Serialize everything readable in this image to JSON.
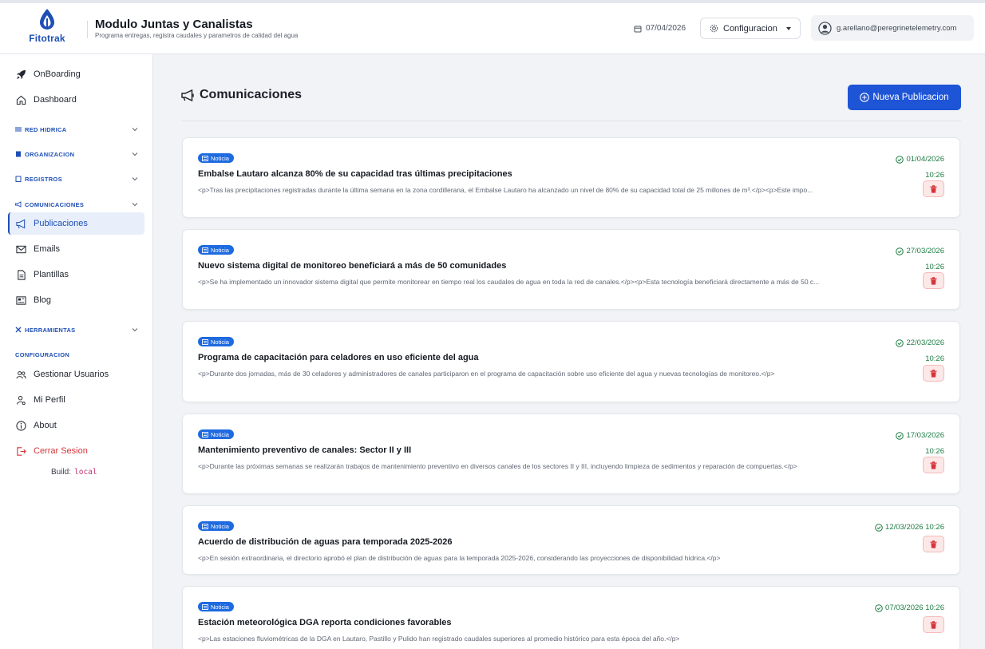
{
  "brand": {
    "name": "Fitotrak"
  },
  "header": {
    "title": "Modulo Juntas y Canalistas",
    "subtitle": "Programa entregas, registra caudales y parametros de calidad del agua",
    "date": "07/04/2026",
    "config_label": "Configuracion",
    "user_email": "g.arellano@peregrinetelemetry.com"
  },
  "sidebar": {
    "onboarding": "OnBoarding",
    "dashboard": "Dashboard",
    "sec_red": "RED HIDRICA",
    "sec_org": "ORGANIZACION",
    "sec_reg": "REGISTROS",
    "sec_com": "COMUNICACIONES",
    "publicaciones": "Publicaciones",
    "emails": "Emails",
    "plantillas": "Plantillas",
    "blog": "Blog",
    "sec_herr": "HERRAMIENTAS",
    "sec_cfg": "CONFIGURACION",
    "usuarios": "Gestionar Usuarios",
    "perfil": "Mi Perfil",
    "about": "About",
    "logout": "Cerrar Sesion",
    "build_label": "Build:",
    "build_value": "local"
  },
  "main": {
    "title": "Comunicaciones",
    "new_button": "Nueva Publicacion"
  },
  "posts": [
    {
      "badge": "Noticia",
      "title": "Embalse Lautaro alcanza 80% de su capacidad tras últimas precipitaciones",
      "body": "<p>Tras las precipitaciones registradas durante la última semana en la zona cordillerana, el Embalse Lautaro ha alcanzado un nivel de 80% de su capacidad total de 25 millones de m³.</p><p>Este impo...",
      "date": "01/04/2026",
      "time": "10:26"
    },
    {
      "badge": "Noticia",
      "title": "Nuevo sistema digital de monitoreo beneficiará a más de 50 comunidades",
      "body": "<p>Se ha implementado un innovador sistema digital que permite monitorear en tiempo real los caudales de agua en toda la red de canales.</p><p>Esta tecnología beneficiará directamente a más de 50 c...",
      "date": "27/03/2026",
      "time": "10:26"
    },
    {
      "badge": "Noticia",
      "title": "Programa de capacitación para celadores en uso eficiente del agua",
      "body": "<p>Durante dos jornadas, más de 30 celadores y administradores de canales participaron en el programa de capacitación sobre uso eficiente del agua y nuevas tecnologías de monitoreo.</p>",
      "date": "22/03/2026",
      "time": "10:26"
    },
    {
      "badge": "Noticia",
      "title": "Mantenimiento preventivo de canales: Sector II y III",
      "body": "<p>Durante las próximas semanas se realizarán trabajos de mantenimiento preventivo en diversos canales de los sectores II y III, incluyendo limpieza de sedimentos y reparación de compuertas.</p>",
      "date": "17/03/2026",
      "time": "10:26"
    },
    {
      "badge": "Noticia",
      "title": "Acuerdo de distribución de aguas para temporada 2025-2026",
      "body": "<p>En sesión extraordinaria, el directorio aprobó el plan de distribución de aguas para la temporada 2025-2026, considerando las proyecciones de disponibilidad hídrica.</p>",
      "date": "12/03/2026 10:26",
      "time": ""
    },
    {
      "badge": "Noticia",
      "title": "Estación meteorológica DGA reporta condiciones favorables",
      "body": "<p>Las estaciones fluviométricas de la DGA en Lautaro, Pastillo y Pulido han registrado caudales superiores al promedio histórico para esta época del año.</p>",
      "date": "07/03/2026 10:26",
      "time": ""
    }
  ],
  "colors": {
    "primary": "#1e54d6",
    "success": "#1d7d44",
    "danger": "#d6353b"
  }
}
